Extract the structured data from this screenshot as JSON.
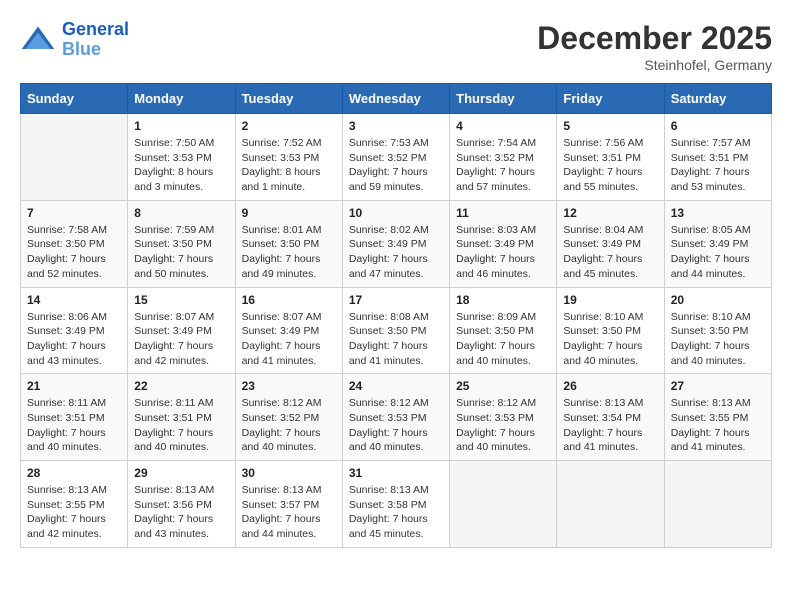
{
  "header": {
    "logo_line1": "General",
    "logo_line2": "Blue",
    "month_title": "December 2025",
    "subtitle": "Steinhofel, Germany"
  },
  "weekdays": [
    "Sunday",
    "Monday",
    "Tuesday",
    "Wednesday",
    "Thursday",
    "Friday",
    "Saturday"
  ],
  "weeks": [
    [
      {
        "day": "",
        "info": ""
      },
      {
        "day": "1",
        "info": "Sunrise: 7:50 AM\nSunset: 3:53 PM\nDaylight: 8 hours\nand 3 minutes."
      },
      {
        "day": "2",
        "info": "Sunrise: 7:52 AM\nSunset: 3:53 PM\nDaylight: 8 hours\nand 1 minute."
      },
      {
        "day": "3",
        "info": "Sunrise: 7:53 AM\nSunset: 3:52 PM\nDaylight: 7 hours\nand 59 minutes."
      },
      {
        "day": "4",
        "info": "Sunrise: 7:54 AM\nSunset: 3:52 PM\nDaylight: 7 hours\nand 57 minutes."
      },
      {
        "day": "5",
        "info": "Sunrise: 7:56 AM\nSunset: 3:51 PM\nDaylight: 7 hours\nand 55 minutes."
      },
      {
        "day": "6",
        "info": "Sunrise: 7:57 AM\nSunset: 3:51 PM\nDaylight: 7 hours\nand 53 minutes."
      }
    ],
    [
      {
        "day": "7",
        "info": "Sunrise: 7:58 AM\nSunset: 3:50 PM\nDaylight: 7 hours\nand 52 minutes."
      },
      {
        "day": "8",
        "info": "Sunrise: 7:59 AM\nSunset: 3:50 PM\nDaylight: 7 hours\nand 50 minutes."
      },
      {
        "day": "9",
        "info": "Sunrise: 8:01 AM\nSunset: 3:50 PM\nDaylight: 7 hours\nand 49 minutes."
      },
      {
        "day": "10",
        "info": "Sunrise: 8:02 AM\nSunset: 3:49 PM\nDaylight: 7 hours\nand 47 minutes."
      },
      {
        "day": "11",
        "info": "Sunrise: 8:03 AM\nSunset: 3:49 PM\nDaylight: 7 hours\nand 46 minutes."
      },
      {
        "day": "12",
        "info": "Sunrise: 8:04 AM\nSunset: 3:49 PM\nDaylight: 7 hours\nand 45 minutes."
      },
      {
        "day": "13",
        "info": "Sunrise: 8:05 AM\nSunset: 3:49 PM\nDaylight: 7 hours\nand 44 minutes."
      }
    ],
    [
      {
        "day": "14",
        "info": "Sunrise: 8:06 AM\nSunset: 3:49 PM\nDaylight: 7 hours\nand 43 minutes."
      },
      {
        "day": "15",
        "info": "Sunrise: 8:07 AM\nSunset: 3:49 PM\nDaylight: 7 hours\nand 42 minutes."
      },
      {
        "day": "16",
        "info": "Sunrise: 8:07 AM\nSunset: 3:49 PM\nDaylight: 7 hours\nand 41 minutes."
      },
      {
        "day": "17",
        "info": "Sunrise: 8:08 AM\nSunset: 3:50 PM\nDaylight: 7 hours\nand 41 minutes."
      },
      {
        "day": "18",
        "info": "Sunrise: 8:09 AM\nSunset: 3:50 PM\nDaylight: 7 hours\nand 40 minutes."
      },
      {
        "day": "19",
        "info": "Sunrise: 8:10 AM\nSunset: 3:50 PM\nDaylight: 7 hours\nand 40 minutes."
      },
      {
        "day": "20",
        "info": "Sunrise: 8:10 AM\nSunset: 3:50 PM\nDaylight: 7 hours\nand 40 minutes."
      }
    ],
    [
      {
        "day": "21",
        "info": "Sunrise: 8:11 AM\nSunset: 3:51 PM\nDaylight: 7 hours\nand 40 minutes."
      },
      {
        "day": "22",
        "info": "Sunrise: 8:11 AM\nSunset: 3:51 PM\nDaylight: 7 hours\nand 40 minutes."
      },
      {
        "day": "23",
        "info": "Sunrise: 8:12 AM\nSunset: 3:52 PM\nDaylight: 7 hours\nand 40 minutes."
      },
      {
        "day": "24",
        "info": "Sunrise: 8:12 AM\nSunset: 3:53 PM\nDaylight: 7 hours\nand 40 minutes."
      },
      {
        "day": "25",
        "info": "Sunrise: 8:12 AM\nSunset: 3:53 PM\nDaylight: 7 hours\nand 40 minutes."
      },
      {
        "day": "26",
        "info": "Sunrise: 8:13 AM\nSunset: 3:54 PM\nDaylight: 7 hours\nand 41 minutes."
      },
      {
        "day": "27",
        "info": "Sunrise: 8:13 AM\nSunset: 3:55 PM\nDaylight: 7 hours\nand 41 minutes."
      }
    ],
    [
      {
        "day": "28",
        "info": "Sunrise: 8:13 AM\nSunset: 3:55 PM\nDaylight: 7 hours\nand 42 minutes."
      },
      {
        "day": "29",
        "info": "Sunrise: 8:13 AM\nSunset: 3:56 PM\nDaylight: 7 hours\nand 43 minutes."
      },
      {
        "day": "30",
        "info": "Sunrise: 8:13 AM\nSunset: 3:57 PM\nDaylight: 7 hours\nand 44 minutes."
      },
      {
        "day": "31",
        "info": "Sunrise: 8:13 AM\nSunset: 3:58 PM\nDaylight: 7 hours\nand 45 minutes."
      },
      {
        "day": "",
        "info": ""
      },
      {
        "day": "",
        "info": ""
      },
      {
        "day": "",
        "info": ""
      }
    ]
  ]
}
